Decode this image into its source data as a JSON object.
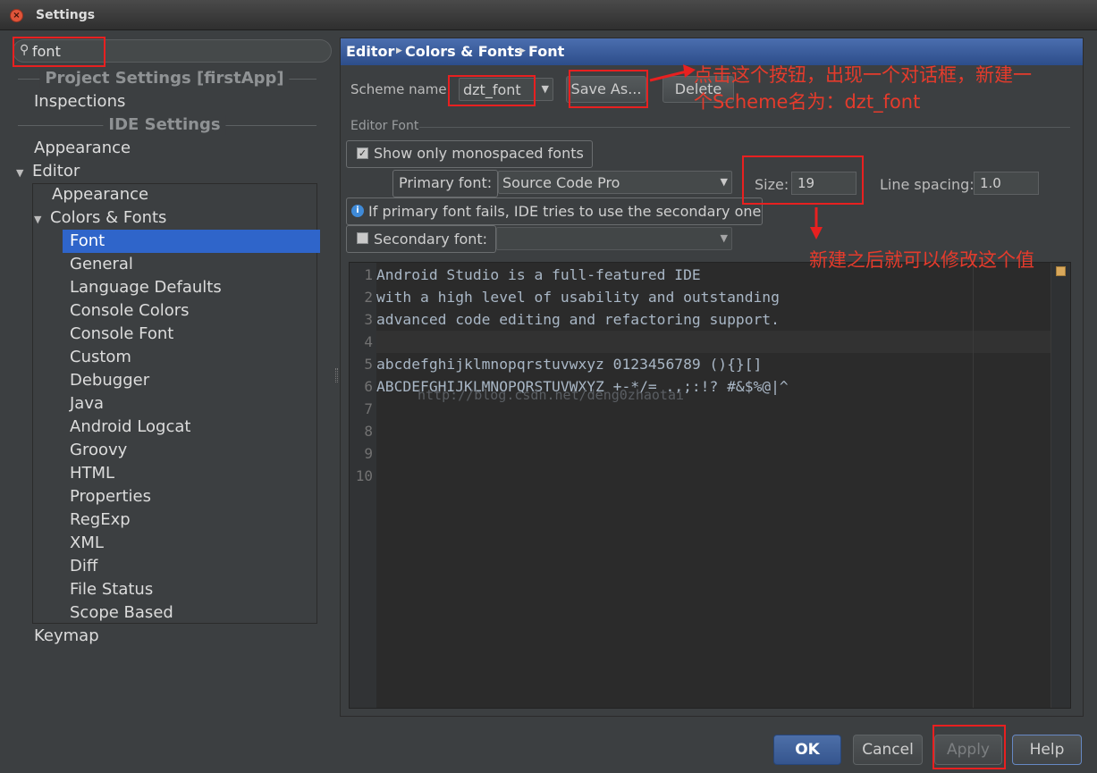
{
  "window": {
    "title": "Settings",
    "close_glyph": "×"
  },
  "search": {
    "icon": "search-icon",
    "value": "font"
  },
  "tree": {
    "project_settings": "Project Settings [firstApp]",
    "inspections": "Inspections",
    "ide_settings": "IDE Settings",
    "appearance": "Appearance",
    "editor": "Editor",
    "editor_children": {
      "appearance": "Appearance",
      "colors_fonts": "Colors & Fonts",
      "colors_fonts_children": [
        "Font",
        "General",
        "Language Defaults",
        "Console Colors",
        "Console Font",
        "Custom",
        "Debugger",
        "Java",
        "Android Logcat",
        "Groovy",
        "HTML",
        "Properties",
        "RegExp",
        "XML",
        "Diff",
        "File Status",
        "Scope Based"
      ]
    },
    "keymap": "Keymap",
    "expanded_glyph": "▼"
  },
  "breadcrumb": [
    "Editor",
    "Colors & Fonts",
    "Font"
  ],
  "breadcrumb_sep": "▶",
  "scheme": {
    "label": "Scheme name:",
    "value": "dzt_font",
    "save_as": "Save As...",
    "delete": "Delete"
  },
  "editor_font": {
    "section_label": "Editor Font",
    "show_mono_label": "Show only monospaced fonts",
    "show_mono_checked": true,
    "primary_label": "Primary font:",
    "primary_value": "Source Code Pro",
    "size_label": "Size:",
    "size_value": "19",
    "line_spacing_label": "Line spacing:",
    "line_spacing_value": "1.0",
    "info_text": "If primary font fails, IDE tries to use the secondary one",
    "secondary_label": "Secondary font:",
    "secondary_value": "",
    "secondary_checked": false,
    "dropdown_glyph": "▼",
    "check_glyph": "✓",
    "info_glyph": "i"
  },
  "preview": {
    "line_numbers": [
      "1",
      "2",
      "3",
      "4",
      "5",
      "6",
      "7",
      "8",
      "9",
      "10"
    ],
    "lines": [
      "Android Studio is a full-featured IDE",
      "with a high level of usability and outstanding",
      "advanced code editing and refactoring support.",
      "",
      "abcdefghijklmnopqrstuvwxyz 0123456789 (){}[]",
      "ABCDEFGHIJKLMNOPQRSTUVWXYZ +-*/= .,;:!? #&$%@|^"
    ],
    "watermark": "http://blog.csdn.net/deng0zhaotai"
  },
  "buttons": {
    "ok": "OK",
    "cancel": "Cancel",
    "apply": "Apply",
    "help": "Help"
  },
  "annotations": {
    "save_as_note_1": "点击这个按钮，出现一个对话框，新建一",
    "save_as_note_2": "个Scheme名为：dzt_font",
    "size_note": "新建之后就可以修改这个值",
    "color": "#e82020"
  },
  "colors": {
    "accent": "#2f65ca",
    "header": "#4b6eaf",
    "background": "#3c3f41",
    "editor_bg": "#2b2b2b"
  }
}
